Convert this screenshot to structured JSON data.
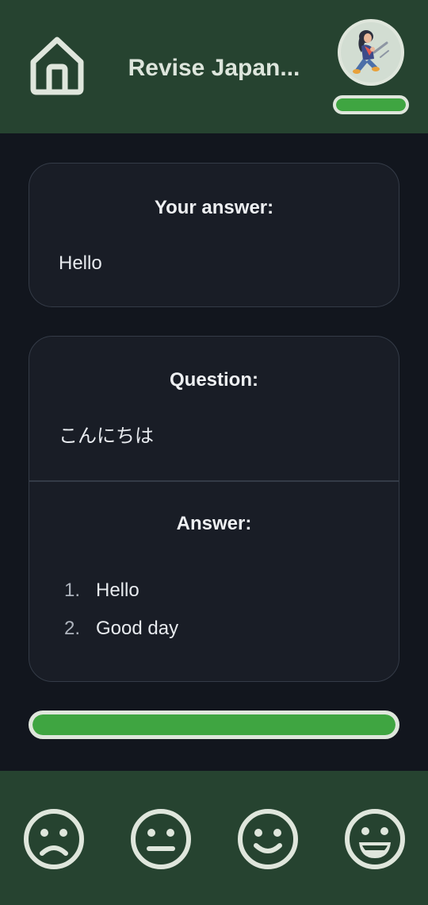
{
  "header": {
    "title": "Revise Japan...",
    "home_icon": "home-icon",
    "avatar_icon": "user-avatar-illustration",
    "session_progress": 1.0
  },
  "your_answer": {
    "heading": "Your answer:",
    "text": "Hello"
  },
  "question": {
    "heading": "Question:",
    "text": "こんにちは"
  },
  "answer": {
    "heading": "Answer:",
    "items": [
      {
        "num": "1.",
        "text": "Hello"
      },
      {
        "num": "2.",
        "text": "Good day"
      }
    ]
  },
  "progress": {
    "value": 1.0
  },
  "ratings": [
    {
      "icon": "sad-face-icon"
    },
    {
      "icon": "neutral-face-icon"
    },
    {
      "icon": "smile-face-icon"
    },
    {
      "icon": "grin-face-icon"
    }
  ],
  "colors": {
    "header_bg": "#264330",
    "body_bg": "#12161e",
    "card_bg": "#191d26",
    "accent_green": "#3fa541",
    "icon_light": "#dfe6dc"
  }
}
